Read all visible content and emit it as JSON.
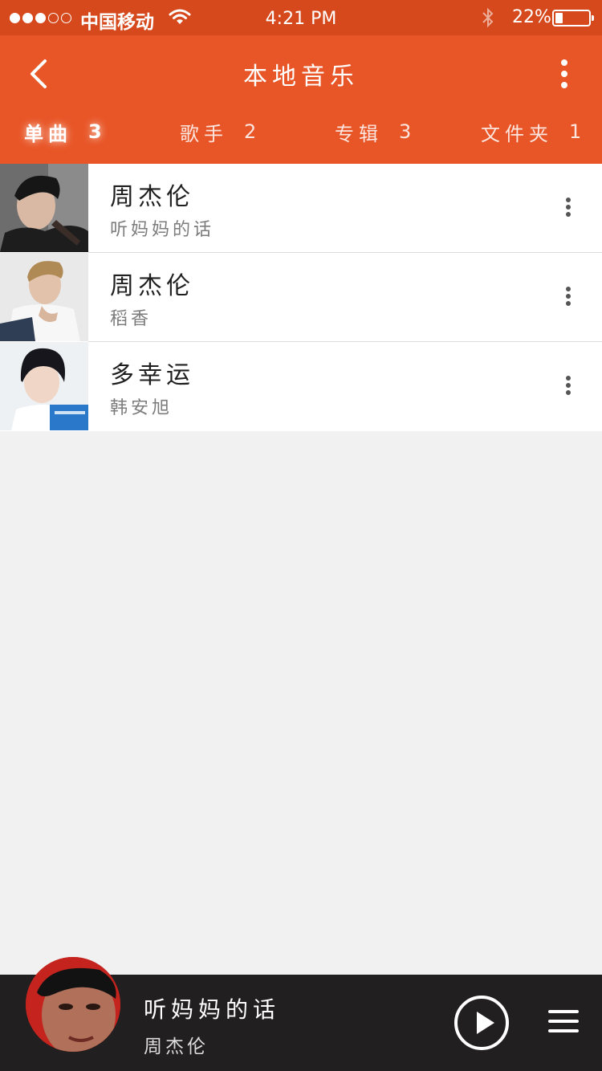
{
  "status_bar": {
    "signal_filled": 3,
    "signal_total": 5,
    "carrier": "中国移动",
    "time": "4:21 PM",
    "battery_percent_label": "22%",
    "battery_level": 0.22,
    "icons": [
      "wifi-icon",
      "bluetooth-icon",
      "battery-icon"
    ]
  },
  "header": {
    "title": "本地音乐",
    "back_icon": "chevron-left-icon",
    "more_icon": "more-vertical-icon"
  },
  "tabs": [
    {
      "label": "单曲",
      "count": "3",
      "active": true
    },
    {
      "label": "歌手",
      "count": "2",
      "active": false
    },
    {
      "label": "专辑",
      "count": "3",
      "active": false
    },
    {
      "label": "文件夹",
      "count": "1",
      "active": false
    }
  ],
  "songs": [
    {
      "artist": "周杰伦",
      "title": "听妈妈的话",
      "cover_icon": "album-cover"
    },
    {
      "artist": "周杰伦",
      "title": "稻香",
      "cover_icon": "album-cover"
    },
    {
      "artist": "多幸运",
      "title": "韩安旭",
      "cover_icon": "album-cover"
    }
  ],
  "player": {
    "title": "听妈妈的话",
    "artist": "周杰伦",
    "play_icon": "play-icon",
    "playlist_icon": "playlist-icon"
  },
  "colors": {
    "status_bar": "#d5491d",
    "header": "#e85526",
    "background": "#f1f1f1",
    "player_bar": "#211f20"
  }
}
